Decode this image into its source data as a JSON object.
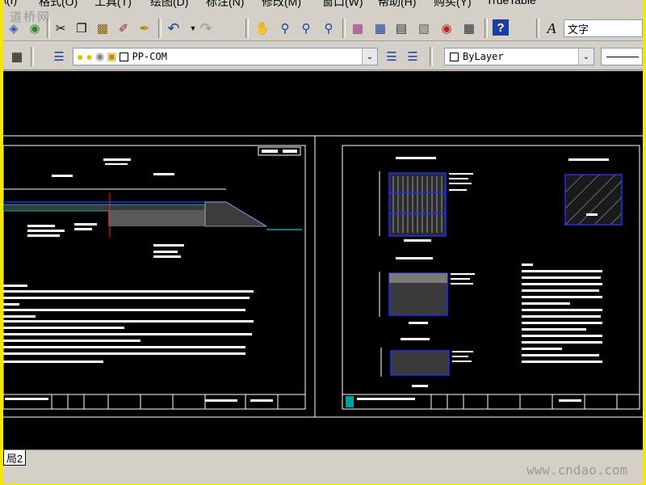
{
  "menu": {
    "items": [
      "绘图(D)",
      "标注(N)",
      "修改(M)",
      "窗口(W)",
      "帮助(H)",
      "购买(Y)",
      "TrueTable"
    ],
    "partial_left": "格式(O)",
    "partial_tools": "工具(T)"
  },
  "toolbar": {
    "text_style_value": "文字",
    "layer_value": "PP-COM",
    "color_value": "ByLayer"
  },
  "tabs": {
    "layout2": "局2"
  },
  "watermark": {
    "top_left": "道桥网",
    "bottom_right": "www.cndao.com"
  },
  "colors": {
    "canvas": "#000000",
    "chrome": "#d4d0c8",
    "border": "#f5e70a",
    "line_blue": "#1f2cff",
    "line_red": "#ff2020",
    "line_cyan": "#00ffff"
  }
}
